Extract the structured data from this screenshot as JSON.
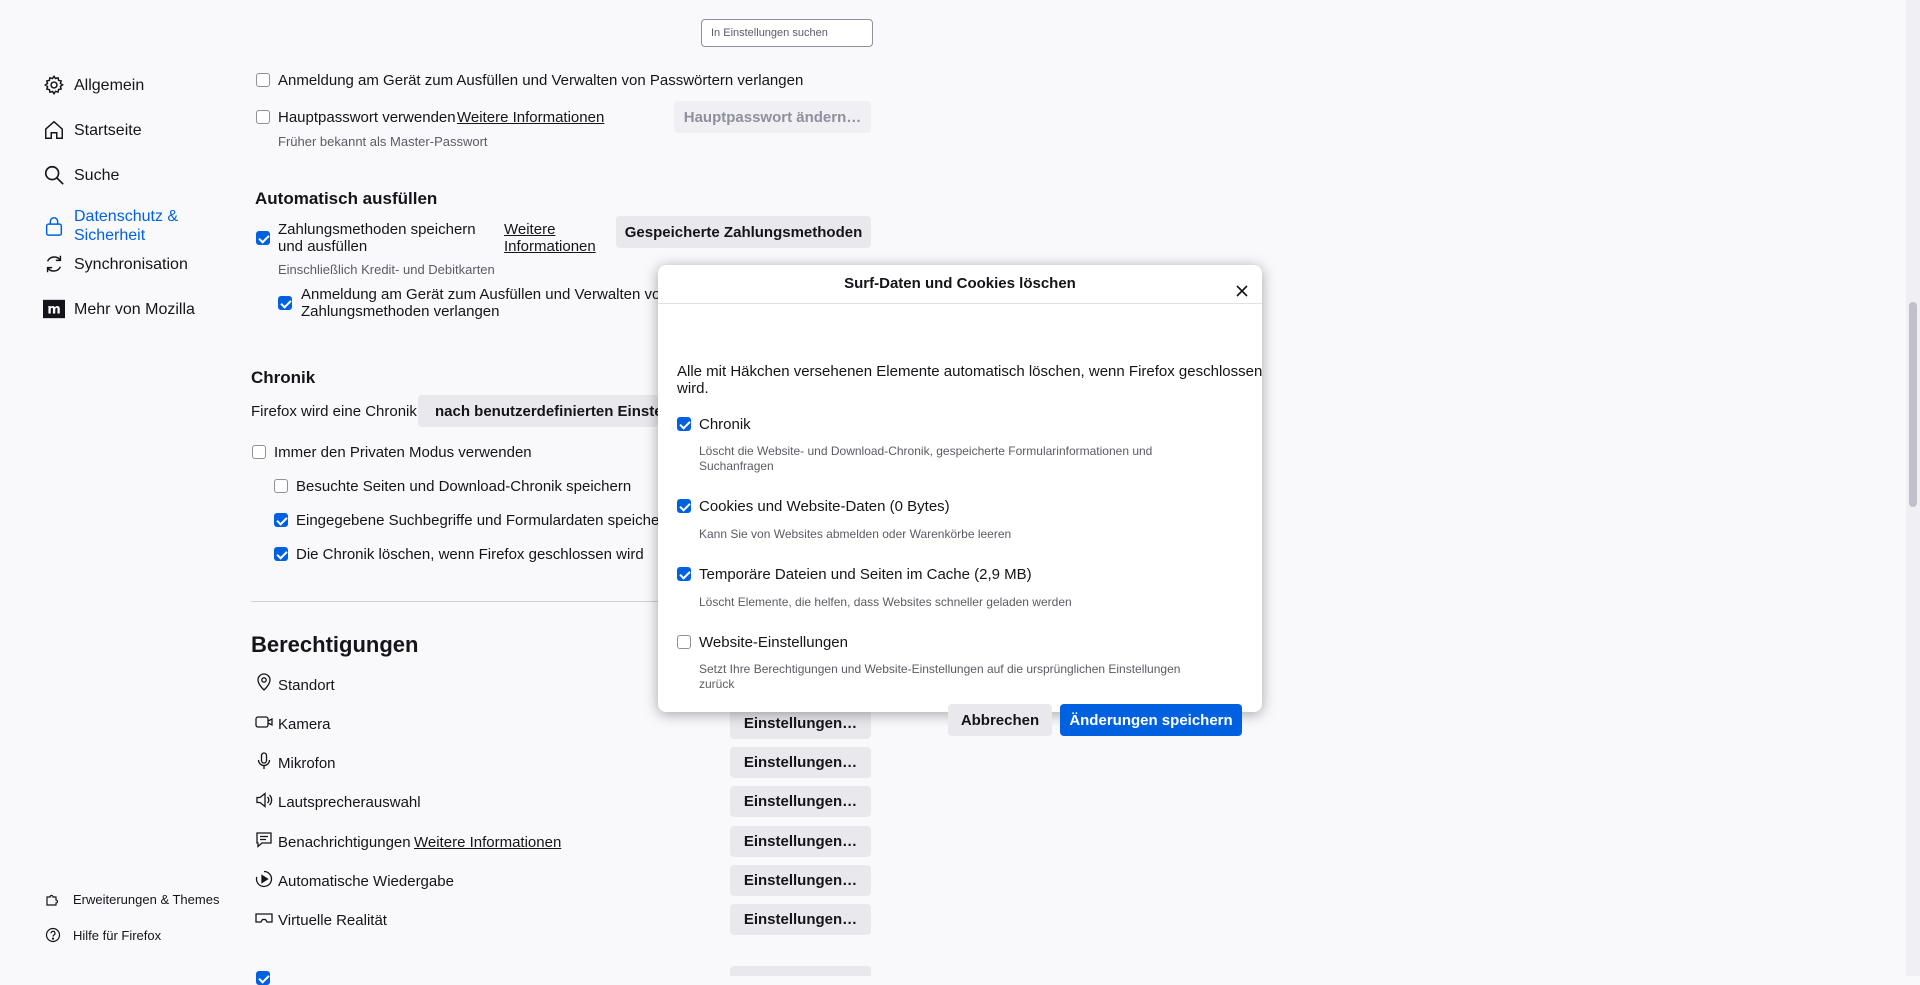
{
  "search": {
    "placeholder": "In Einstellungen suchen"
  },
  "sidebar": {
    "items": [
      {
        "label": "Allgemein",
        "icon": "gear-icon"
      },
      {
        "label": "Startseite",
        "icon": "home-icon"
      },
      {
        "label": "Suche",
        "icon": "search-icon"
      },
      {
        "label": "Datenschutz & Sicherheit",
        "icon": "lock-icon"
      },
      {
        "label": "Synchronisation",
        "icon": "sync-icon"
      },
      {
        "label": "Mehr von Mozilla",
        "icon": "mozilla-icon"
      }
    ],
    "footer": [
      {
        "label": "Erweiterungen & Themes",
        "icon": "puzzle-icon"
      },
      {
        "label": "Hilfe für Firefox",
        "icon": "help-icon"
      }
    ]
  },
  "passwords": {
    "device_auth": "Anmeldung am Gerät zum Ausfüllen und Verwalten von Passwörtern verlangen",
    "master_password": "Hauptpasswort verwenden",
    "master_link": "Weitere Informationen",
    "master_button": "Hauptpasswort ändern…",
    "master_note": "Früher bekannt als Master-Passwort"
  },
  "autofill": {
    "heading": "Automatisch ausfüllen",
    "payment_line1": "Zahlungsmethoden speichern",
    "payment_line2": "und ausfüllen",
    "payment_link1": "Weitere",
    "payment_link2": "Informationen",
    "payment_button": "Gespeicherte Zahlungsmethoden",
    "payment_note": "Einschließlich Kredit- und Debitkarten",
    "device_auth_line1": "Anmeldung am Gerät zum Ausfüllen und Verwalten von",
    "device_auth_line2": "Zahlungsmethoden verlangen"
  },
  "history": {
    "heading": "Chronik",
    "mode_label": "Firefox wird eine Chronik",
    "mode_value": "nach benutzerdefinierten Einstellungen anlegen",
    "private_mode": "Immer den Privaten Modus verwenden",
    "browsing": "Besuchte Seiten und Download-Chronik speichern",
    "search_form": "Eingegebene Suchbegriffe und Formulardaten speichern",
    "clear_on_close": "Die Chronik löschen, wenn Firefox geschlossen wird"
  },
  "permissions": {
    "heading": "Berechtigungen",
    "button_label": "Einstellungen…",
    "items": [
      {
        "label": "Standort",
        "icon": "location-icon"
      },
      {
        "label": "Kamera",
        "icon": "camera-icon"
      },
      {
        "label": "Mikrofon",
        "icon": "microphone-icon"
      },
      {
        "label": "Lautsprecherauswahl",
        "icon": "speaker-icon"
      },
      {
        "label": "Benachrichtigungen",
        "icon": "notification-icon",
        "link": "Weitere Informationen"
      },
      {
        "label": "Automatische Wiedergabe",
        "icon": "autoplay-icon"
      },
      {
        "label": "Virtuelle Realität",
        "icon": "vr-icon"
      }
    ]
  },
  "dialog": {
    "title": "Surf-Daten und Cookies löschen",
    "intro_line1": "Alle mit Häkchen versehenen Elemente automatisch löschen, wenn Firefox geschlossen",
    "intro_line2": "wird.",
    "options": [
      {
        "label": "Chronik",
        "checked": true,
        "desc_line1": "Löscht die Website- und Download-Chronik, gespeicherte Formularinformationen und",
        "desc_line2": "Suchanfragen"
      },
      {
        "label": "Cookies und Website-Daten (0 Bytes)",
        "checked": true,
        "desc_line1": "Kann Sie von Websites abmelden oder Warenkörbe leeren",
        "desc_line2": ""
      },
      {
        "label": "Temporäre Dateien und Seiten im Cache (2,9 MB)",
        "checked": true,
        "desc_line1": "Löscht Elemente, die helfen, dass Websites schneller geladen werden",
        "desc_line2": ""
      },
      {
        "label": "Website-Einstellungen",
        "checked": false,
        "desc_line1": "Setzt Ihre Berechtigungen und Website-Einstellungen auf die ursprünglichen Einstellungen",
        "desc_line2": "zurück"
      }
    ],
    "cancel": "Abbrechen",
    "save": "Änderungen speichern"
  },
  "colors": {
    "accent": "#0061e0",
    "background": "#f9f9fb",
    "button": "#e9e9ed"
  }
}
